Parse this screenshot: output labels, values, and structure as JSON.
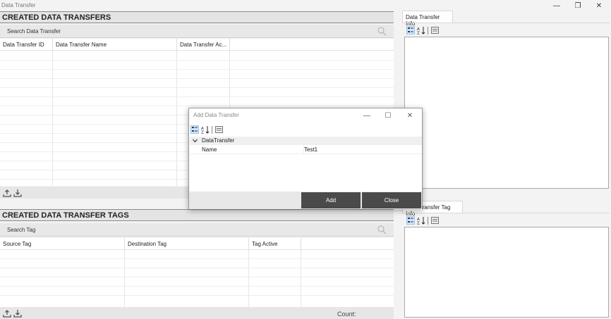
{
  "window": {
    "title": "Data Transfer"
  },
  "transfers": {
    "header": "CREATED DATA TRANSFERS",
    "search_placeholder": "Search Data Transfer",
    "columns": [
      "Data Transfer ID",
      "Data Transfer Name",
      "Data Transfer Ac..."
    ]
  },
  "tags": {
    "header": "CREATED DATA TRANSFER TAGS",
    "search_placeholder": "Search Tag",
    "columns": [
      "Source Tag",
      "Destination Tag",
      "Tag Active"
    ],
    "count_label": "Count:"
  },
  "info_panel": {
    "tab": "Data Transfer Info"
  },
  "tag_info_panel": {
    "tab": "Data Transfer Tag Info"
  },
  "dialog": {
    "title": "Add Data Transfer",
    "group": "DataTransfer",
    "property_name": "Name",
    "property_value": "Test1",
    "add_label": "Add",
    "close_label": "Close"
  },
  "icons": {
    "categorized": "categorized-icon",
    "sort": "sort-alpha-icon",
    "property_pages": "property-pages-icon",
    "search": "search-icon",
    "export": "export-icon",
    "import": "import-icon"
  },
  "colors": {
    "accent": "#cfe5f7",
    "button_dark": "#4a4a4a"
  }
}
